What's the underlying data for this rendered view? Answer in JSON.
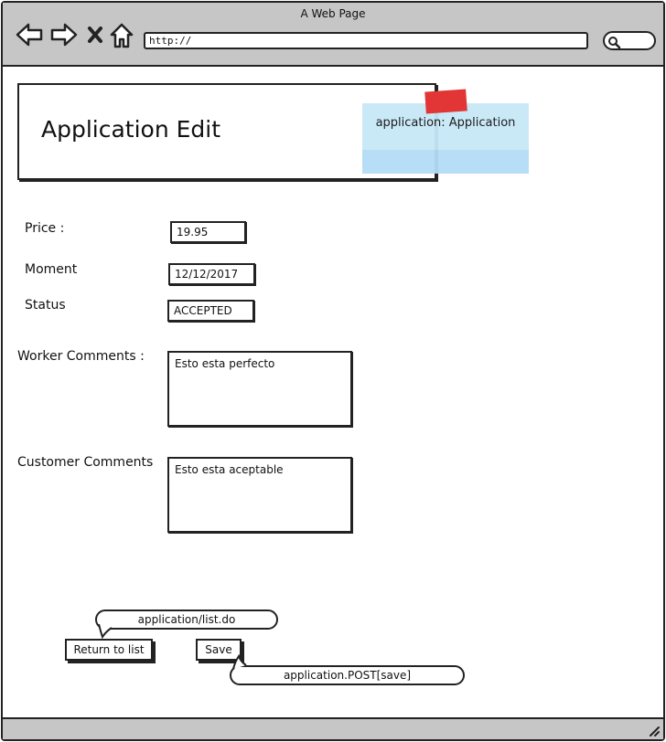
{
  "window": {
    "title": "A Web Page"
  },
  "browser": {
    "url": "http://"
  },
  "header": {
    "title": "Application Edit",
    "note": "application: Application"
  },
  "form": {
    "price": {
      "label": "Price :",
      "value": "19.95"
    },
    "moment": {
      "label": "Moment",
      "value": "12/12/2017"
    },
    "status": {
      "label": "Status",
      "value": "ACCEPTED"
    },
    "worker_comments": {
      "label": "Worker Comments :",
      "value": "Esto esta perfecto"
    },
    "customer_comments": {
      "label": "Customer Comments",
      "value": "Esto esta aceptable"
    }
  },
  "actions": {
    "return_label": "Return to list",
    "return_link": "application/list.do",
    "save_label": "Save",
    "save_action": "application.POST[save]"
  },
  "colors": {
    "chrome": "#c6c6c6",
    "sticky_note": "#c8e8f7",
    "tape": "#e23636"
  }
}
